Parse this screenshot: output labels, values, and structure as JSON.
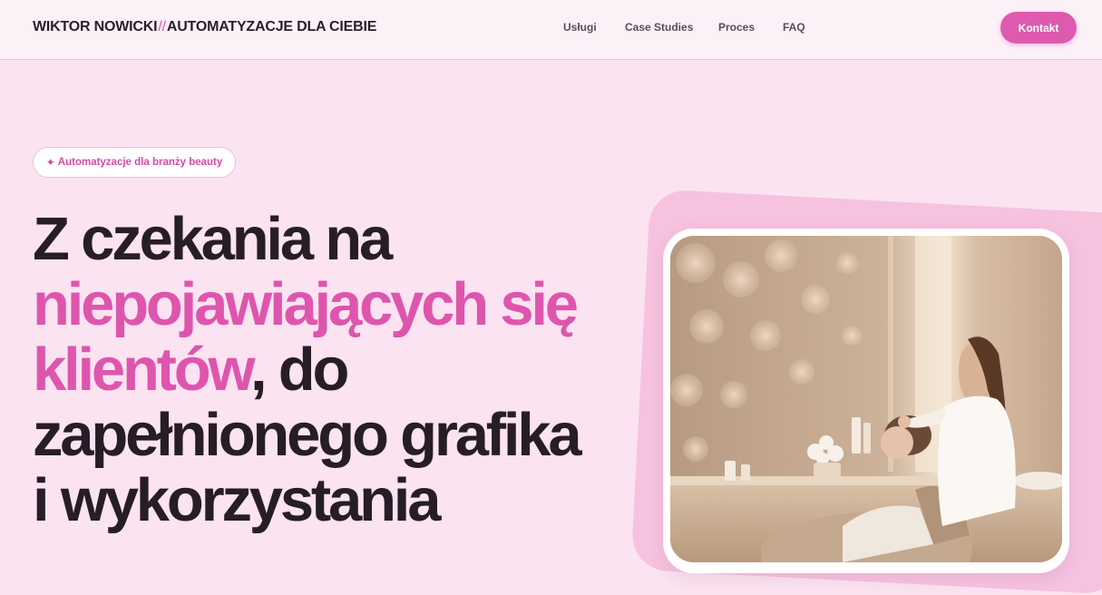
{
  "header": {
    "brand_name": "WIKTOR NOWICKI",
    "brand_separator": "//",
    "brand_tagline": "AUTOMATYZACJE DLA CIEBIE",
    "nav": [
      {
        "label": "Usługi"
      },
      {
        "label": "Case Studies"
      },
      {
        "label": "Proces"
      },
      {
        "label": "FAQ"
      }
    ],
    "cta_label": "Kontakt"
  },
  "hero": {
    "badge_icon": "sparkle-icon",
    "badge_label": "Automatyzacje dla branży beauty",
    "headline": {
      "line1": "Z czekania na",
      "accent": "niepojawiających się klientów",
      "after_accent": ", do",
      "line4": "zapełnionego grafika",
      "line5": "i wykorzystania"
    },
    "image_subject": "beauty-salon-facial-treatment"
  },
  "colors": {
    "accent": "#de55ad",
    "background": "#fbe3f1",
    "header_bg": "#fdf1f8",
    "text": "#271d27"
  }
}
